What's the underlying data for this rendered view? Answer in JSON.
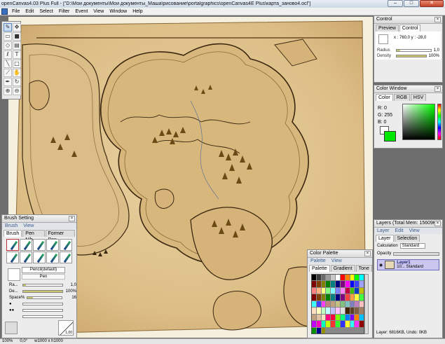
{
  "window": {
    "title": "openCanvas4.03 Plus Full - [\"D:\\Мои документы\\Мои документы_Маша\\рисование\\portalgraphics\\openCanvas4E Plus\\карта_заново4.ocl\"]",
    "minimize": "–",
    "maximize": "□",
    "close": "✕"
  },
  "menu": [
    "File",
    "Edit",
    "Select",
    "Filter",
    "Event",
    "View",
    "Window",
    "Help"
  ],
  "toolbox": {
    "tools": [
      "brush-tool",
      "move-tool",
      "rect-select-tool",
      "fill-color-tool",
      "eraser-tool",
      "gradient-tool",
      "lasso-tool",
      "text-tool",
      "line-tool",
      "shape-tool",
      "eyedropper-tool",
      "hand-tool",
      "pen-tool",
      "rotate-tool",
      "zoom-in-tool",
      "zoom-out-tool"
    ],
    "glyphs": [
      "✎",
      "✥",
      "▭",
      "■",
      "◇",
      "▤",
      "ℓ",
      "T",
      "╲",
      "□",
      "⟋",
      "✋",
      "✒",
      "↻",
      "⊕",
      "⊖"
    ]
  },
  "control": {
    "title": "Control",
    "tabs": [
      "Preview",
      "Control"
    ],
    "coords": "x : 760,0   y : -28,0",
    "radius_label": "Radius",
    "radius_value": "1,0",
    "radius_fill": 0.1,
    "density_label": "Density",
    "density_value": "100%",
    "density_fill": 1.0
  },
  "color_window": {
    "title": "Color Window",
    "tabs": [
      "Color",
      "RGB",
      "HSV"
    ],
    "r": "R:   0",
    "g": "G: 255",
    "b": "B:   0",
    "current_color": "#00e800"
  },
  "brush": {
    "title": "Brush Setting",
    "menu": [
      "Brush",
      "View"
    ],
    "tabs": [
      "Brush",
      "Pen Nib",
      "Former Pen"
    ],
    "name": "Pencil(default)",
    "sub": "Pen",
    "radius_label": "Ra...",
    "radius_value": "1,0",
    "density_label": "De...",
    "density_value": "100%",
    "space_label": "Space%",
    "space_value": "16",
    "pressure_value": "1,00"
  },
  "palette": {
    "title": "Color Palette",
    "menu": [
      "Palette",
      "View"
    ],
    "tabs": [
      "Palette",
      "Gradient",
      "Tone"
    ],
    "colors": [
      "#000000",
      "#3a3a3a",
      "#6b6b6b",
      "#9a9a9a",
      "#c8c8c8",
      "#ffffff",
      "#ff0000",
      "#ff7f00",
      "#ffff00",
      "#00ff00",
      "#00ffff",
      "#7f0000",
      "#7f3f00",
      "#7f7f00",
      "#007f00",
      "#007f7f",
      "#00007f",
      "#7f007f",
      "#ff00ff",
      "#0000ff",
      "#3f3fff",
      "#a0a0ff",
      "#ff8080",
      "#ffb080",
      "#ffff80",
      "#80ff80",
      "#80ffff",
      "#8080ff",
      "#ff80ff",
      "#c00040",
      "#40c000",
      "#0040c0",
      "#c0c000",
      "#800000",
      "#804000",
      "#808000",
      "#008000",
      "#008080",
      "#000080",
      "#800080",
      "#ff4040",
      "#ffa040",
      "#ffff40",
      "#40ff40",
      "#40ffff",
      "#4040ff",
      "#ff40ff",
      "#c08080",
      "#c0a080",
      "#c0c080",
      "#80c080",
      "#80c0c0",
      "#8080c0",
      "#c080c0",
      "#ffc0c0",
      "#ffe0c0",
      "#ffffc0",
      "#c0ffc0",
      "#c0ffff",
      "#c0c0ff",
      "#ffc0ff",
      "#e0e0e0",
      "#402000",
      "#604020",
      "#806040",
      "#a08060",
      "#c0a080",
      "#e0c0a0",
      "#ffe0c0",
      "#ff0080",
      "#ff0040",
      "#80ff00",
      "#00ff80",
      "#0080ff",
      "#8000ff",
      "#ff8000",
      "#00c0ff",
      "#c000ff",
      "#ff00c0",
      "#00ffc0",
      "#c0ff00",
      "#ff3030",
      "#30ff30",
      "#3030ff",
      "#ffff30",
      "#30ffff",
      "#ff30ff",
      "#900000",
      "#009000",
      "#000090",
      "#909000"
    ]
  },
  "layers": {
    "title": "Layers (Total Mem: 15609KB)",
    "menu": [
      "Layer",
      "Edit",
      "View"
    ],
    "tabs": [
      "Layer",
      "Selection"
    ],
    "calc_label": "Calculation",
    "calc_value": "Standard",
    "opacity_label": "Opacity",
    "layer_name": "Layer1",
    "layer_info": "10...   Standard",
    "footer": "Layer: 6816KB, Undo: 0KB"
  },
  "status": {
    "zoom": "100%",
    "angle": "0,0°",
    "size": "w1000 x h1000"
  }
}
